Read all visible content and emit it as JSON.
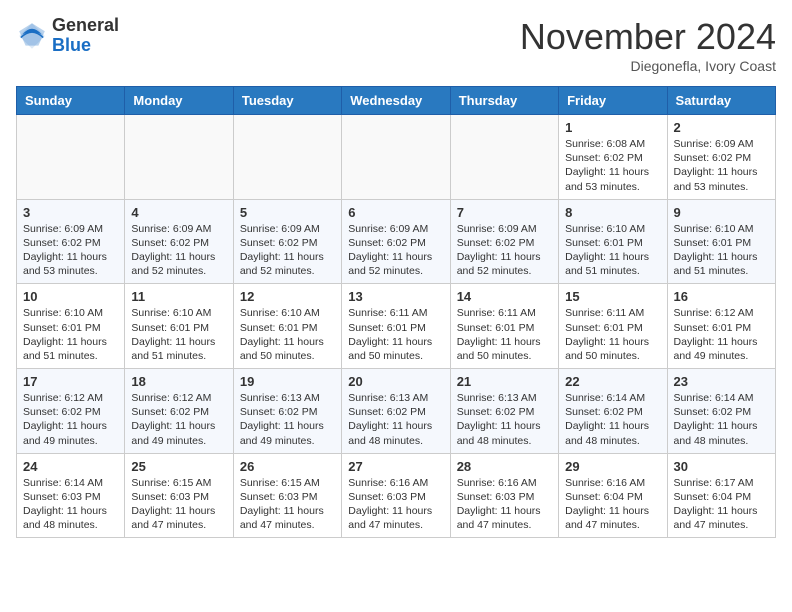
{
  "header": {
    "logo_general": "General",
    "logo_blue": "Blue",
    "month_title": "November 2024",
    "location": "Diegonefla, Ivory Coast"
  },
  "weekdays": [
    "Sunday",
    "Monday",
    "Tuesday",
    "Wednesday",
    "Thursday",
    "Friday",
    "Saturday"
  ],
  "weeks": [
    [
      {
        "day": "",
        "info": ""
      },
      {
        "day": "",
        "info": ""
      },
      {
        "day": "",
        "info": ""
      },
      {
        "day": "",
        "info": ""
      },
      {
        "day": "",
        "info": ""
      },
      {
        "day": "1",
        "info": "Sunrise: 6:08 AM\nSunset: 6:02 PM\nDaylight: 11 hours and 53 minutes."
      },
      {
        "day": "2",
        "info": "Sunrise: 6:09 AM\nSunset: 6:02 PM\nDaylight: 11 hours and 53 minutes."
      }
    ],
    [
      {
        "day": "3",
        "info": "Sunrise: 6:09 AM\nSunset: 6:02 PM\nDaylight: 11 hours and 53 minutes."
      },
      {
        "day": "4",
        "info": "Sunrise: 6:09 AM\nSunset: 6:02 PM\nDaylight: 11 hours and 52 minutes."
      },
      {
        "day": "5",
        "info": "Sunrise: 6:09 AM\nSunset: 6:02 PM\nDaylight: 11 hours and 52 minutes."
      },
      {
        "day": "6",
        "info": "Sunrise: 6:09 AM\nSunset: 6:02 PM\nDaylight: 11 hours and 52 minutes."
      },
      {
        "day": "7",
        "info": "Sunrise: 6:09 AM\nSunset: 6:02 PM\nDaylight: 11 hours and 52 minutes."
      },
      {
        "day": "8",
        "info": "Sunrise: 6:10 AM\nSunset: 6:01 PM\nDaylight: 11 hours and 51 minutes."
      },
      {
        "day": "9",
        "info": "Sunrise: 6:10 AM\nSunset: 6:01 PM\nDaylight: 11 hours and 51 minutes."
      }
    ],
    [
      {
        "day": "10",
        "info": "Sunrise: 6:10 AM\nSunset: 6:01 PM\nDaylight: 11 hours and 51 minutes."
      },
      {
        "day": "11",
        "info": "Sunrise: 6:10 AM\nSunset: 6:01 PM\nDaylight: 11 hours and 51 minutes."
      },
      {
        "day": "12",
        "info": "Sunrise: 6:10 AM\nSunset: 6:01 PM\nDaylight: 11 hours and 50 minutes."
      },
      {
        "day": "13",
        "info": "Sunrise: 6:11 AM\nSunset: 6:01 PM\nDaylight: 11 hours and 50 minutes."
      },
      {
        "day": "14",
        "info": "Sunrise: 6:11 AM\nSunset: 6:01 PM\nDaylight: 11 hours and 50 minutes."
      },
      {
        "day": "15",
        "info": "Sunrise: 6:11 AM\nSunset: 6:01 PM\nDaylight: 11 hours and 50 minutes."
      },
      {
        "day": "16",
        "info": "Sunrise: 6:12 AM\nSunset: 6:01 PM\nDaylight: 11 hours and 49 minutes."
      }
    ],
    [
      {
        "day": "17",
        "info": "Sunrise: 6:12 AM\nSunset: 6:02 PM\nDaylight: 11 hours and 49 minutes."
      },
      {
        "day": "18",
        "info": "Sunrise: 6:12 AM\nSunset: 6:02 PM\nDaylight: 11 hours and 49 minutes."
      },
      {
        "day": "19",
        "info": "Sunrise: 6:13 AM\nSunset: 6:02 PM\nDaylight: 11 hours and 49 minutes."
      },
      {
        "day": "20",
        "info": "Sunrise: 6:13 AM\nSunset: 6:02 PM\nDaylight: 11 hours and 48 minutes."
      },
      {
        "day": "21",
        "info": "Sunrise: 6:13 AM\nSunset: 6:02 PM\nDaylight: 11 hours and 48 minutes."
      },
      {
        "day": "22",
        "info": "Sunrise: 6:14 AM\nSunset: 6:02 PM\nDaylight: 11 hours and 48 minutes."
      },
      {
        "day": "23",
        "info": "Sunrise: 6:14 AM\nSunset: 6:02 PM\nDaylight: 11 hours and 48 minutes."
      }
    ],
    [
      {
        "day": "24",
        "info": "Sunrise: 6:14 AM\nSunset: 6:03 PM\nDaylight: 11 hours and 48 minutes."
      },
      {
        "day": "25",
        "info": "Sunrise: 6:15 AM\nSunset: 6:03 PM\nDaylight: 11 hours and 47 minutes."
      },
      {
        "day": "26",
        "info": "Sunrise: 6:15 AM\nSunset: 6:03 PM\nDaylight: 11 hours and 47 minutes."
      },
      {
        "day": "27",
        "info": "Sunrise: 6:16 AM\nSunset: 6:03 PM\nDaylight: 11 hours and 47 minutes."
      },
      {
        "day": "28",
        "info": "Sunrise: 6:16 AM\nSunset: 6:03 PM\nDaylight: 11 hours and 47 minutes."
      },
      {
        "day": "29",
        "info": "Sunrise: 6:16 AM\nSunset: 6:04 PM\nDaylight: 11 hours and 47 minutes."
      },
      {
        "day": "30",
        "info": "Sunrise: 6:17 AM\nSunset: 6:04 PM\nDaylight: 11 hours and 47 minutes."
      }
    ]
  ]
}
